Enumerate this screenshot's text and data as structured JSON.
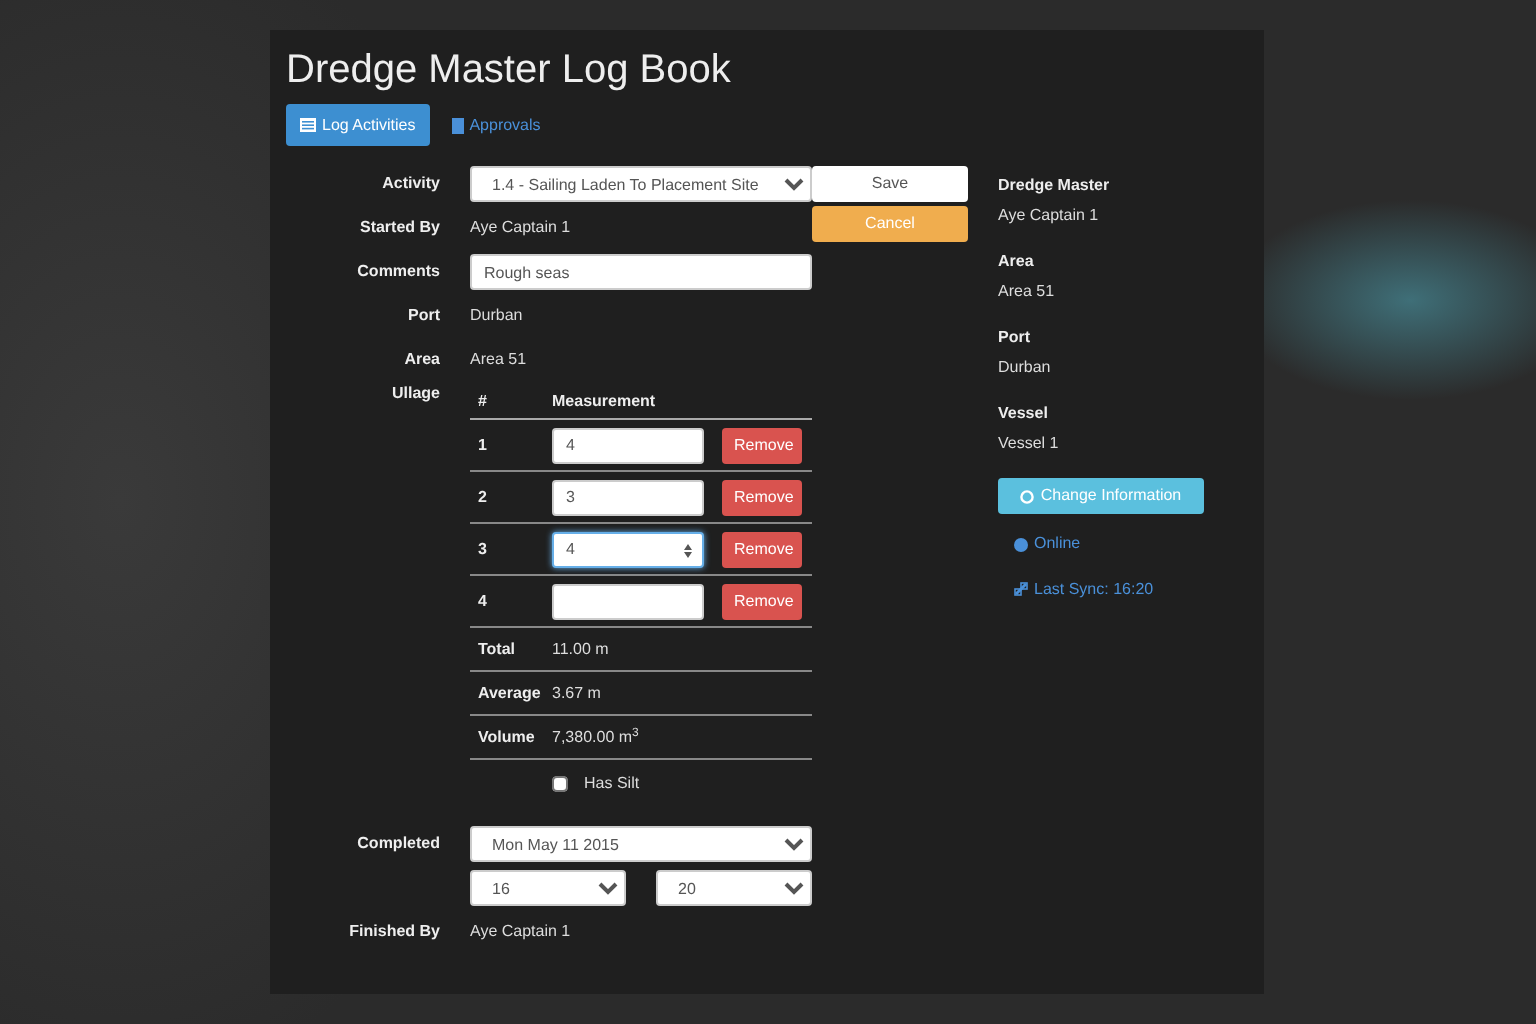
{
  "title": "Dredge Master Log Book",
  "tabs": [
    {
      "label": "Log Activities",
      "selected": true
    },
    {
      "label": "Approvals",
      "selected": false
    }
  ],
  "form": {
    "activity": {
      "label": "Activity",
      "value": "1.4 - Sailing Laden To Placement Site"
    },
    "started_by": {
      "label": "Started By",
      "value": "Aye Captain 1"
    },
    "comments": {
      "label": "Comments",
      "value": "Rough seas"
    },
    "port": {
      "label": "Port",
      "value": "Durban"
    },
    "area": {
      "label": "Area",
      "value": "Area 51"
    },
    "ullage": {
      "label": "Ullage",
      "columns": [
        "#",
        "Measurement"
      ],
      "rows": [
        {
          "number": "1",
          "value": "4",
          "focused": false,
          "button": "Remove"
        },
        {
          "number": "2",
          "value": "3",
          "focused": false,
          "button": "Remove"
        },
        {
          "number": "3",
          "value": "4",
          "focused": true,
          "button": "Remove"
        },
        {
          "number": "4",
          "value": "",
          "focused": false,
          "button": "Remove"
        }
      ],
      "summary": [
        {
          "label": "Total",
          "value": "11.00 m"
        },
        {
          "label": "Average",
          "value": "3.67 m"
        },
        {
          "label": "Volume",
          "value": "7,380.00 m$^{3}$"
        }
      ],
      "has_silt": {
        "label": "Has Silt",
        "checked": false
      }
    },
    "completed": {
      "label": "Completed",
      "date": "Mon May 11 2015",
      "hour": "16",
      "minute": "20"
    },
    "finished_by": {
      "label": "Finished By",
      "value": "Aye Captain 1"
    }
  },
  "actions": [
    {
      "label": "Save",
      "kind": "default"
    },
    {
      "label": "Cancel",
      "kind": "warning"
    }
  ],
  "info": [
    {
      "label": "Dredge Master",
      "value": "Aye Captain 1"
    },
    {
      "label": "Area",
      "value": "Area 51"
    },
    {
      "label": "Port",
      "value": "Durban"
    },
    {
      "label": "Vessel",
      "value": "Vessel 1"
    }
  ],
  "change_button": "Change Information",
  "status_links": [
    {
      "label": "Online",
      "kind": "globe"
    },
    {
      "label": "Last Sync: 16:20",
      "kind": "link"
    }
  ]
}
